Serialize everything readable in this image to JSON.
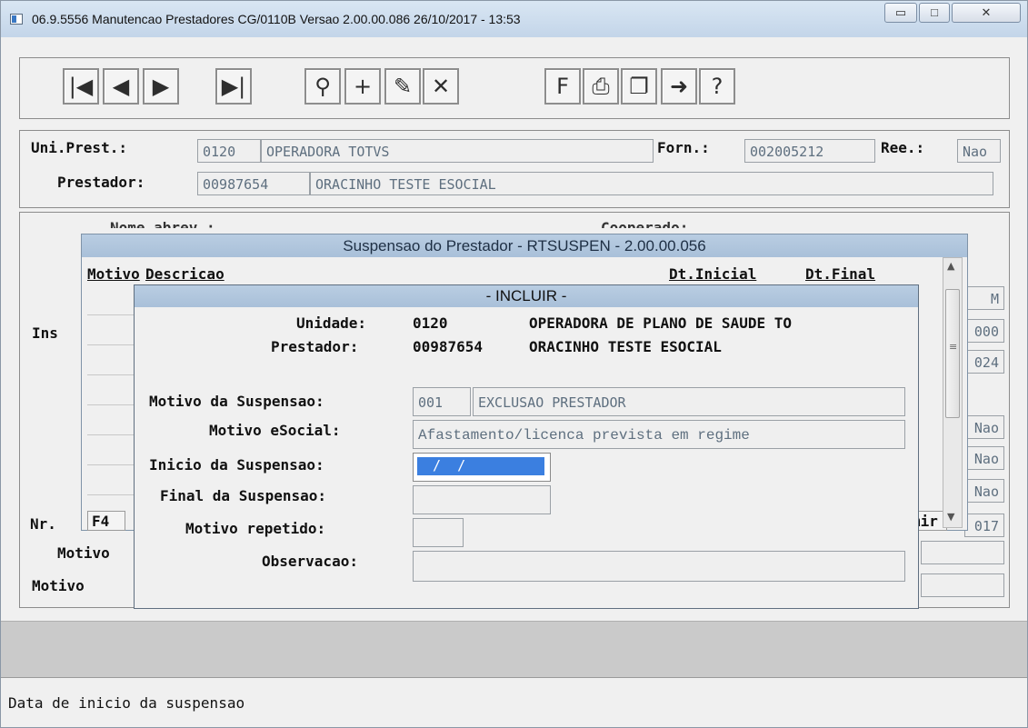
{
  "window": {
    "title": "06.9.5556 Manutencao  Prestadores CG/0110B Versao 2.00.00.086 26/10/2017 - 13:53",
    "controls": {
      "minimize": "▭",
      "maximize": "□",
      "close": "✕"
    }
  },
  "toolbar": {
    "buttons": [
      {
        "name": "first-record-icon",
        "glyph": "|◀"
      },
      {
        "name": "previous-record-icon",
        "glyph": "◀"
      },
      {
        "name": "next-record-icon",
        "glyph": "▶"
      },
      {
        "name": "last-record-icon",
        "glyph": "▶|"
      },
      {
        "name": "search-key-icon",
        "glyph": "⚲"
      },
      {
        "name": "add-record-icon",
        "glyph": "+"
      },
      {
        "name": "edit-record-icon",
        "glyph": "✎"
      },
      {
        "name": "delete-record-icon",
        "glyph": "✕"
      },
      {
        "name": "filter-icon",
        "glyph": "F"
      },
      {
        "name": "print-icon",
        "glyph": "⎙"
      },
      {
        "name": "copy-icon",
        "glyph": "❐"
      },
      {
        "name": "exit-icon",
        "glyph": "➜"
      },
      {
        "name": "help-icon",
        "glyph": "?"
      }
    ]
  },
  "header": {
    "uni_prest_label": "Uni.Prest.:",
    "uni_prest_code": "0120",
    "uni_prest_name": "OPERADORA TOTVS",
    "forn_label": "Forn.:",
    "forn_value": "002005212",
    "ree_label": "Ree.:",
    "ree_value": "Nao",
    "prestador_label": "Prestador:",
    "prestador_code": "00987654",
    "prestador_name": "ORACINHO TESTE ESOCIAL"
  },
  "background_form": {
    "nome_abrev_label": "Nome abrev.:",
    "cooperado_label": "Cooperado:",
    "ins_label": "Ins",
    "nr_label": "Nr.",
    "motivo1_label": "Motivo",
    "motivo2_label": "Motivo",
    "right_values": [
      "M",
      "000",
      "024",
      "Nao",
      "Nao",
      "Nao",
      "017"
    ],
    "f4_label": "F4",
    "imir_label": "mir"
  },
  "suspensao_dialog": {
    "title": "Suspensao do Prestador - RTSUSPEN - 2.00.00.056",
    "columns": [
      "Motivo",
      "Descricao",
      "Dt.Inicial",
      "Dt.Final"
    ]
  },
  "incluir_dialog": {
    "title": "- INCLUIR -",
    "unidade_label": "Unidade:",
    "unidade_code": "0120",
    "unidade_name": "OPERADORA DE PLANO DE SAUDE TO",
    "prestador_label": "Prestador:",
    "prestador_code": "00987654",
    "prestador_name": "ORACINHO TESTE ESOCIAL",
    "motivo_suspensao_label": "Motivo da Suspensao:",
    "motivo_suspensao_code": "001",
    "motivo_suspensao_desc": "EXCLUSAO PRESTADOR",
    "motivo_esocial_label": "Motivo eSocial:",
    "motivo_esocial_value": "Afastamento/licenca prevista em regime",
    "inicio_label": "Inicio da Suspensao:",
    "inicio_value": " /  / ",
    "final_label": "Final da Suspensao:",
    "final_value": "",
    "repetido_label": "Motivo repetido:",
    "repetido_value": "",
    "observacao_label": "Observacao:",
    "observacao_value": ""
  },
  "status": {
    "message": "Data de inicio da suspensao"
  }
}
